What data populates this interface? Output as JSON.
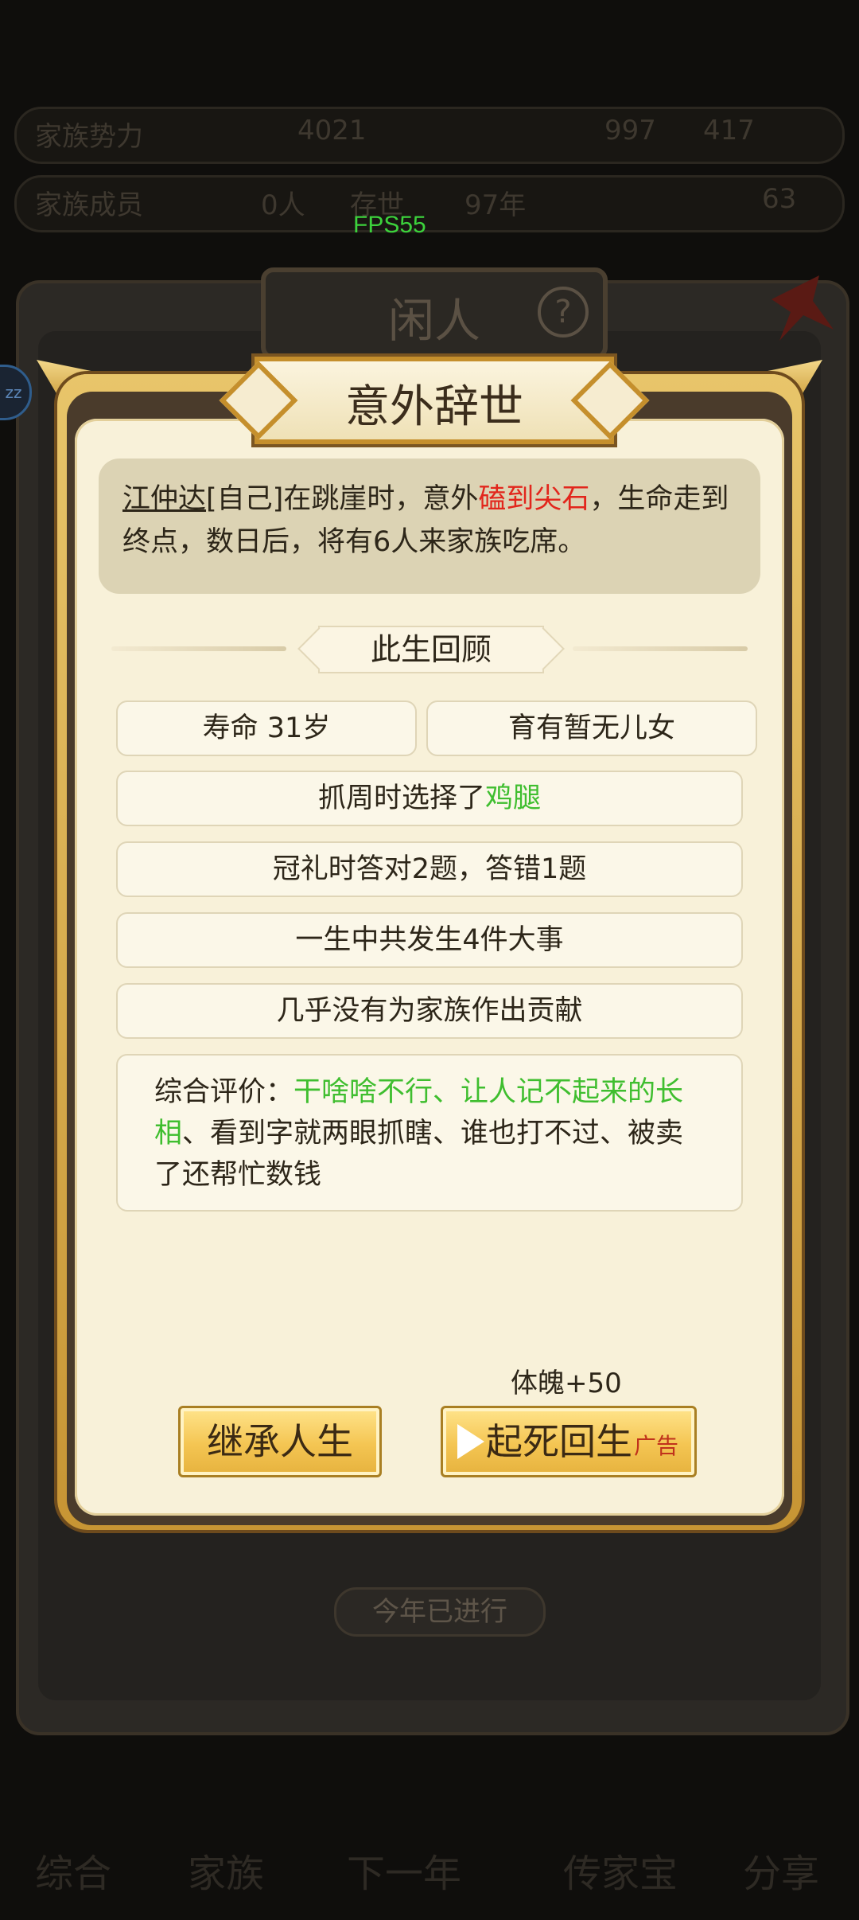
{
  "background": {
    "stats_row1": [
      "家族势力",
      "4021",
      "997",
      "417"
    ],
    "stats_row2": [
      "家族成员",
      "0人",
      "存世",
      "97年",
      "63"
    ],
    "status_title": "闲人",
    "year_progress": "今年已进行",
    "nav": [
      "综合",
      "家族",
      "下一年",
      "传家宝",
      "分享"
    ],
    "side_badge": "zz",
    "fps": "FPS55"
  },
  "modal": {
    "title": "意外辞世",
    "story": {
      "name": "江仲达",
      "self_tag": "[自己]",
      "text1": "在跳崖时，意外",
      "cause": "磕到尖石",
      "text2": "，生命走到终点，数日后，将有6人来家族吃席。"
    },
    "section_title": "此生回顾",
    "stats": {
      "lifespan": "寿命 31岁",
      "children": "育有暂无儿女",
      "zhuazhou_prefix": "抓周时选择了",
      "zhuazhou_item": "鸡腿",
      "guanli": "冠礼时答对2题，答错1题",
      "events": "一生中共发生4件大事",
      "contribution": "几乎没有为家族作出贡献"
    },
    "review": {
      "label": "综合评价：",
      "traits_green": "干啥啥不行、让人记不起来的长相",
      "traits_rest": "、看到字就两眼抓瞎、谁也打不过、被卖了还帮忙数钱"
    },
    "reward": "体魄+50",
    "buttons": {
      "inherit": "继承人生",
      "revive": "起死回生",
      "revive_ad": "广告"
    }
  }
}
